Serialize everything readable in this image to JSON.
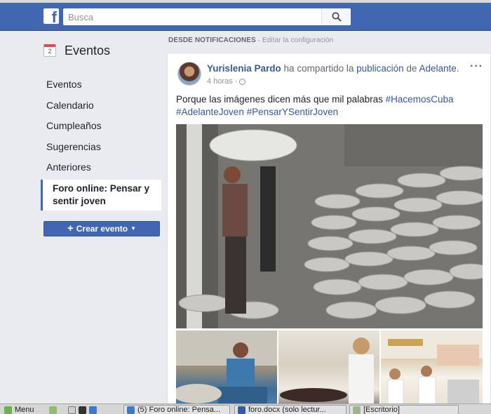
{
  "header": {
    "logo_letter": "f",
    "search_placeholder": "Busca",
    "brand_color": "#4267b2"
  },
  "left_nav": {
    "title": "Eventos",
    "calendar_day": "2",
    "items": [
      {
        "label": "Eventos"
      },
      {
        "label": "Calendario"
      },
      {
        "label": "Cumpleaños"
      },
      {
        "label": "Sugerencias"
      },
      {
        "label": "Anteriores"
      }
    ],
    "active_item": "Foro online: Pensar y sentir joven",
    "create_button": "Crear evento"
  },
  "notifications": {
    "label": "DESDE NOTIFICACIONES",
    "separator": " · ",
    "edit_link": "Editar la configuración"
  },
  "post": {
    "author": "Yurislenia Pardo",
    "action_text": " ha compartido la ",
    "object_link": "publicación",
    "of_text": " de ",
    "page_link": "Adelante",
    "end_text": ".",
    "time": "4 horas",
    "dot": "·",
    "more_label": "···",
    "text": "Porque las imágenes dicen más que mil palabras ",
    "hashtags": [
      "#HacemosCuba",
      "#AdelanteJoven",
      "#PensarYSentirJoven"
    ]
  },
  "taskbar": {
    "menu": "Menu",
    "windows": [
      {
        "label": "(5) Foro online: Pensa..."
      },
      {
        "label": "foro.docx (solo lectur..."
      },
      {
        "label": "[Escritorio]"
      }
    ]
  }
}
